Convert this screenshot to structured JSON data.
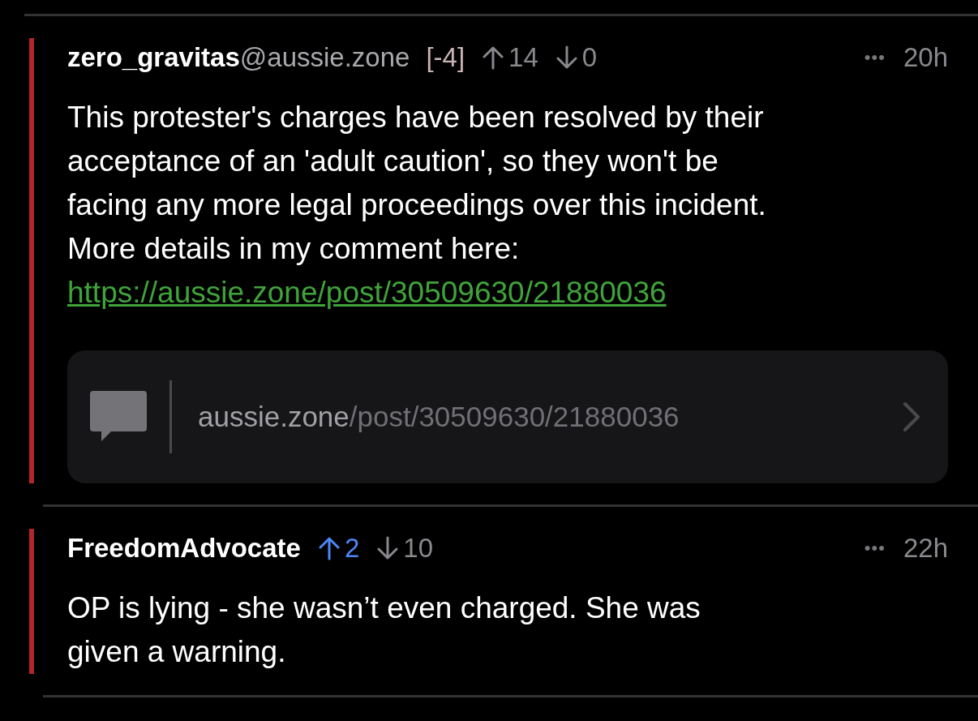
{
  "comments": [
    {
      "author": "zero_gravitas",
      "instance": "@aussie.zone",
      "score_badge": "[-4]",
      "upvotes": "14",
      "upvoted": false,
      "downvotes": "0",
      "downvoted": false,
      "more": "•••",
      "time": "20h",
      "body": "This protester's charges have been resolved by their\nacceptance of an 'adult caution', so they won't be\nfacing any more legal proceedings over this incident.\nMore details in my comment here:",
      "link": "https://aussie.zone/post/30509630/21880036",
      "preview": {
        "domain": "aussie.zone",
        "path": "/post/30509630/21880036"
      }
    },
    {
      "author": "FreedomAdvocate",
      "upvotes": "2",
      "upvoted": true,
      "downvotes": "10",
      "downvoted": false,
      "more": "•••",
      "time": "22h",
      "body": "OP is lying - she wasn’t even charged. She was\ngiven a warning."
    }
  ]
}
